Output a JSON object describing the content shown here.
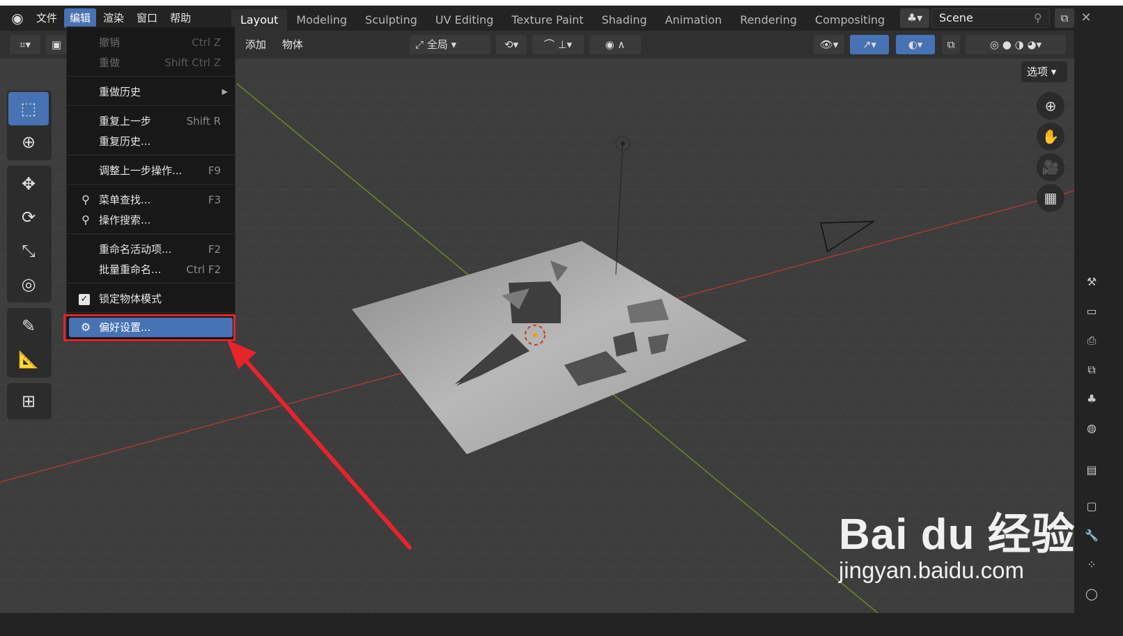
{
  "topbar": {
    "menu": [
      "文件",
      "编辑",
      "渲染",
      "窗口",
      "帮助"
    ],
    "tabs": [
      "Layout",
      "Modeling",
      "Sculpting",
      "UV Editing",
      "Texture Paint",
      "Shading",
      "Animation",
      "Rendering",
      "Compositing"
    ],
    "scene_name": "Scene"
  },
  "header": {
    "add_label": "添加",
    "object_label": "物体",
    "transform_orientation": "全局",
    "options_label": "选项"
  },
  "edit_menu": {
    "undo": {
      "label": "撤销",
      "shortcut": "Ctrl Z"
    },
    "redo": {
      "label": "重做",
      "shortcut": "Shift Ctrl Z"
    },
    "undo_history": {
      "label": "重做历史"
    },
    "repeat_last": {
      "label": "重复上一步",
      "shortcut": "Shift R"
    },
    "repeat_history": {
      "label": "重复历史..."
    },
    "adjust_last": {
      "label": "调整上一步操作...",
      "shortcut": "F9"
    },
    "menu_search": {
      "label": "菜单查找...",
      "shortcut": "F3"
    },
    "operator_search": {
      "label": "操作搜索..."
    },
    "rename_active": {
      "label": "重命名活动项...",
      "shortcut": "F2"
    },
    "batch_rename": {
      "label": "批量重命名...",
      "shortcut": "Ctrl F2"
    },
    "lock_object_modes": {
      "label": "锁定物体模式",
      "checked": true
    },
    "preferences": {
      "label": "偏好设置..."
    }
  },
  "watermark": {
    "brand": "Bai du 经验",
    "url": "jingyan.baidu.com"
  },
  "colors": {
    "accent": "#4772b3",
    "annotation_red": "#e8232b",
    "viewport_bg": "#3d3d3d"
  }
}
